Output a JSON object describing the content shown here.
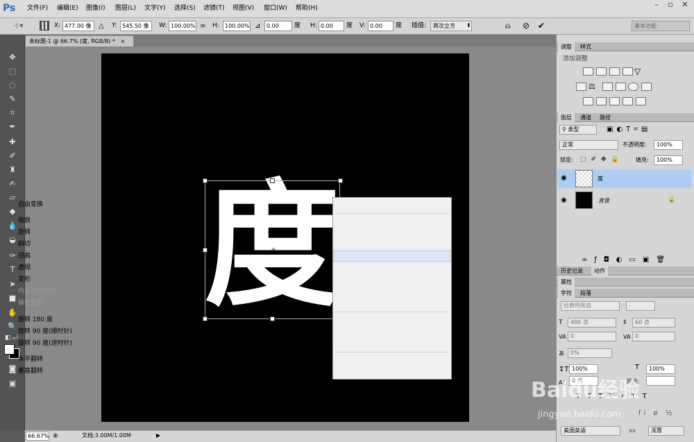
{
  "app": {
    "logo": "Ps"
  },
  "menu": [
    "文件(F)",
    "编辑(E)",
    "图像(I)",
    "图层(L)",
    "文字(Y)",
    "选择(S)",
    "滤镜(T)",
    "视图(V)",
    "窗口(W)",
    "帮助(H)"
  ],
  "options": {
    "x_label": "X:",
    "x_value": "477.00 像",
    "y_label": "Y:",
    "y_value": "545.50 像",
    "w_label": "W:",
    "w_value": "100.00%",
    "h_label": "H:",
    "h_value": "100.00%",
    "angle_value": "0.00",
    "angle_unit": "度",
    "hskew_label": "H:",
    "hskew_value": "0.00",
    "hskew_unit": "度",
    "vskew_label": "V:",
    "vskew_value": "0.00",
    "vskew_unit": "度",
    "interp_label": "插值:",
    "interp_value": "两次立方",
    "workspace": "基本功能"
  },
  "document": {
    "tab_title": "未标题-1 @ 66.7% (度, RGB/8) *",
    "glyph": "度"
  },
  "context_menu": {
    "items": [
      "自由变换",
      "缩放",
      "旋转",
      "斜切",
      "扭曲",
      "透视",
      "变形",
      "内容识别比例",
      "操控变形",
      "旋转 180 度",
      "旋转 90 度(顺时针)",
      "旋转 90 度(逆时针)",
      "水平翻转",
      "垂直翻转"
    ],
    "disabled": [
      "内容识别比例",
      "操控变形"
    ],
    "highlighted": "扭曲"
  },
  "status": {
    "zoom": "66.67%",
    "doc": "文档:3.00M/1.00M"
  },
  "panels": {
    "adjust_tabs": [
      "调整",
      "样式"
    ],
    "adjust_title": "添加调整",
    "layer_tabs": [
      "图层",
      "通道",
      "路径"
    ],
    "layer_filter": "类型",
    "blend_mode": "正常",
    "opacity_label": "不透明度:",
    "opacity_value": "100%",
    "lock_label": "锁定:",
    "fill_label": "填充:",
    "fill_value": "100%",
    "layers": [
      {
        "name": "度"
      },
      {
        "name": "背景"
      }
    ],
    "history_tabs": [
      "历史记录",
      "动作"
    ],
    "props_tab": "属性",
    "char_tabs": [
      "字符",
      "段落"
    ],
    "font_family": "经典特黑简",
    "font_style": "-",
    "font_size": "400 点",
    "leading": "60 点",
    "kerning": "0",
    "tracking": "0",
    "scale_pct": "0%",
    "vscale": "100%",
    "hscale": "100%",
    "baseline": "0 点",
    "color_label": "颜色:",
    "language": "美国英语",
    "aa": "浑厚",
    "watermark": "Baidu经验",
    "watermark_url": "jingyan.baidu.com"
  },
  "colors": {
    "accent": "#2f6fb1",
    "selection": "#aecdf4",
    "menu_highlight": "#dce9f7"
  }
}
